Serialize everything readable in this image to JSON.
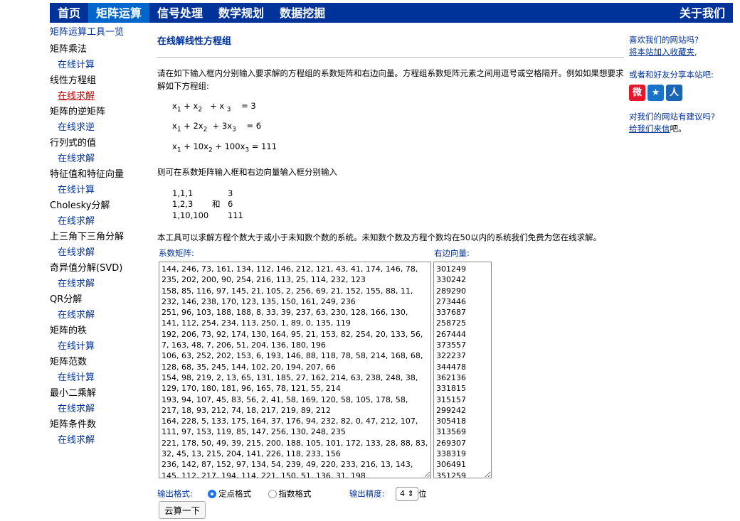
{
  "nav": {
    "items": [
      {
        "label": "首页"
      },
      {
        "label": "矩阵运算",
        "active": true
      },
      {
        "label": "信号处理"
      },
      {
        "label": "数学规划"
      },
      {
        "label": "数据挖掘"
      }
    ],
    "about": "关于我们"
  },
  "sidebar": {
    "heading": "矩阵运算工具一览",
    "groups": [
      {
        "cat": "矩阵乘法",
        "link": "在线计算"
      },
      {
        "cat": "线性方程组",
        "link": "在线求解",
        "active": true
      },
      {
        "cat": "矩阵的逆矩阵",
        "link": "在线求逆"
      },
      {
        "cat": "行列式的值",
        "link": "在线求解"
      },
      {
        "cat": "特征值和特征向量",
        "link": "在线计算"
      },
      {
        "cat": "Cholesky分解",
        "link": "在线求解"
      },
      {
        "cat": "上三角下三角分解",
        "link": "在线求解"
      },
      {
        "cat": "奇异值分解(SVD)",
        "link": "在线求解"
      },
      {
        "cat": "QR分解",
        "link": "在线求解"
      },
      {
        "cat": "矩阵的秩",
        "link": "在线计算"
      },
      {
        "cat": "矩阵范数",
        "link": "在线计算"
      },
      {
        "cat": "最小二乘解",
        "link": "在线求解"
      },
      {
        "cat": "矩阵条件数",
        "link": "在线求解"
      }
    ]
  },
  "main": {
    "title": "在线解线性方程组",
    "intro": "请在如下输入框内分别输入要求解的方程组的系数矩阵和右边向量。方程组系数矩阵元素之间用逗号或空格隔开。例如如果想要求解如下方程组:",
    "equations": [
      {
        "lhs": "x1 + x2 + x3",
        "rhs": "= 3"
      },
      {
        "lhs": "x1 + 2x2 + 3x3",
        "rhs": "= 6"
      },
      {
        "lhs": "x1 + 10x2 + 100x3",
        "rhs": "= 111"
      }
    ],
    "mid_text": "则可在系数矩阵输入框和右边向量输入框分别输入",
    "example": {
      "matrix": [
        "1,1,1",
        "1,2,3",
        "1,10,100"
      ],
      "and": "和",
      "vector": [
        "3",
        "6",
        "111"
      ]
    },
    "note": "本工具可以求解方程个数大于或小于未知数个数的系统。未知数个数及方程个数均在50以内的系统我们免费为您在线求解。",
    "matrix_label": "系数矩阵:",
    "vector_label": "右边向量:",
    "matrix_text": "144, 246, 73, 161, 134, 112, 146, 212, 121, 43, 41, 174, 146, 78,\n235, 202, 200, 90, 254, 216, 113, 25, 114, 232, 123\n158, 85, 116, 97, 145, 21, 105, 2, 256, 69, 21, 152, 155, 88, 11,\n232, 146, 238, 170, 123, 135, 150, 161, 249, 236\n251, 96, 103, 188, 188, 8, 33, 39, 237, 63, 230, 128, 166, 130,\n141, 112, 254, 234, 113, 250, 1, 89, 0, 135, 119\n192, 206, 73, 92, 174, 130, 164, 95, 21, 153, 82, 254, 20, 133, 56,\n7, 163, 48, 7, 206, 51, 204, 136, 180, 196\n106, 63, 252, 202, 153, 6, 193, 146, 88, 118, 78, 58, 214, 168, 68,\n128, 68, 35, 245, 144, 102, 20, 194, 207, 66\n154, 98, 219, 2, 13, 65, 131, 185, 27, 162, 214, 63, 238, 248, 38,\n129, 170, 180, 181, 96, 165, 78, 121, 55, 214\n193, 94, 107, 45, 83, 56, 2, 41, 58, 169, 120, 58, 105, 178, 58,\n217, 18, 93, 212, 74, 18, 217, 219, 89, 212\n164, 228, 5, 133, 175, 164, 37, 176, 94, 232, 82, 0, 47, 212, 107,\n111, 97, 153, 119, 85, 147, 256, 130, 248, 235\n221, 178, 50, 49, 39, 215, 200, 188, 105, 101, 172, 133, 28, 88, 83,\n32, 45, 13, 215, 204, 141, 226, 118, 233, 156\n236, 142, 87, 152, 97, 134, 54, 239, 49, 220, 233, 216, 13, 143,\n145, 112, 217, 194, 114, 221, 150, 51, 136, 31, 198",
    "vector_text": "301249\n330242\n289290\n273446\n337687\n258725\n267444\n373557\n322237\n344478\n362136\n331815\n315157\n299242\n305418\n313569\n269307\n338319\n306491\n351259",
    "output_format_label": "输出格式:",
    "fixed_label": "定点格式",
    "sci_label": "指数格式",
    "precision_label": "输出精度:",
    "precision_value": "4",
    "precision_unit": "位",
    "submit": "云算一下"
  },
  "right": {
    "q1": "喜欢我们的网站吗?",
    "fav": "将本站加入收藏夹",
    "comma": ",",
    "share": "或者和好友分享本站吧:",
    "q2": "对我们的网站有建议吗?",
    "mail": "给我们来信",
    "tail": "吧。",
    "icons": [
      {
        "name": "weibo-icon",
        "color": "#e6162d",
        "glyph": "微"
      },
      {
        "name": "star-icon",
        "color": "#1a73c9",
        "glyph": "★"
      },
      {
        "name": "renren-icon",
        "color": "#1c64b5",
        "glyph": "人"
      }
    ]
  }
}
